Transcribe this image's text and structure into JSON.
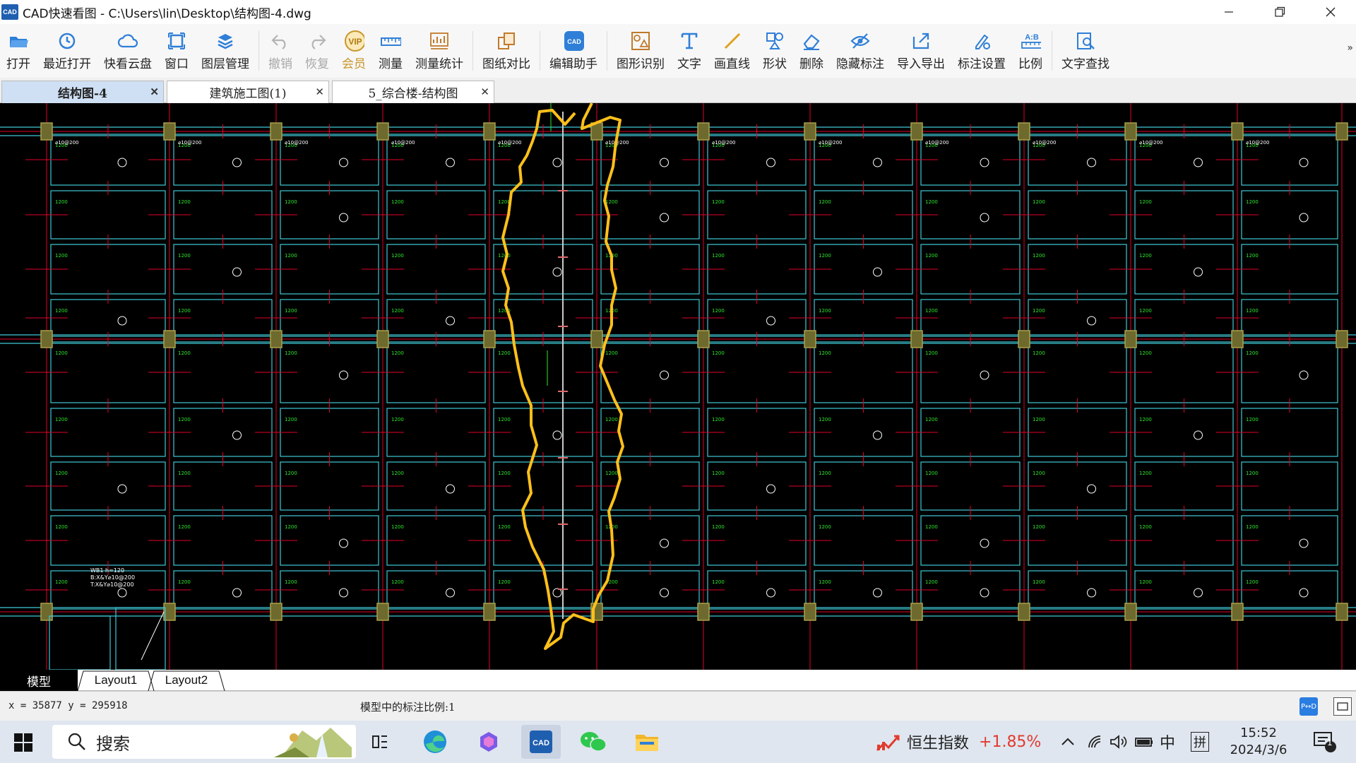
{
  "window": {
    "logo": "CAD",
    "title": "CAD快速看图 - C:\\Users\\lin\\Desktop\\结构图-4.dwg",
    "controls": [
      "minimize",
      "restore",
      "close"
    ]
  },
  "toolbar": {
    "buttons": [
      {
        "label": "打开",
        "icon": "folder-open-icon",
        "disabled": false
      },
      {
        "label": "最近打开",
        "icon": "recent-clock-icon",
        "disabled": false
      },
      {
        "label": "快看云盘",
        "icon": "cloud-icon",
        "disabled": false
      },
      {
        "label": "窗口",
        "icon": "window-icon",
        "disabled": false
      },
      {
        "label": "图层管理",
        "icon": "layers-icon",
        "disabled": false
      },
      {
        "label": "撤销",
        "icon": "undo-icon",
        "disabled": true
      },
      {
        "label": "恢复",
        "icon": "redo-icon",
        "disabled": true
      },
      {
        "label": "会员",
        "icon": "vip-icon",
        "disabled": false
      },
      {
        "label": "测量",
        "icon": "ruler-icon",
        "disabled": false
      },
      {
        "label": "测量统计",
        "icon": "measure-stats-icon",
        "disabled": false
      },
      {
        "label": "图纸对比",
        "icon": "compare-icon",
        "disabled": false
      },
      {
        "label": "编辑助手",
        "icon": "edit-assistant-icon",
        "disabled": false
      },
      {
        "label": "图形识别",
        "icon": "shape-recognize-icon",
        "disabled": false
      },
      {
        "label": "文字",
        "icon": "text-icon",
        "disabled": false
      },
      {
        "label": "画直线",
        "icon": "line-icon",
        "disabled": false
      },
      {
        "label": "形状",
        "icon": "shapes-icon",
        "disabled": false
      },
      {
        "label": "删除",
        "icon": "eraser-icon",
        "disabled": false
      },
      {
        "label": "隐藏标注",
        "icon": "hide-eye-icon",
        "disabled": false
      },
      {
        "label": "导入导出",
        "icon": "import-export-icon",
        "disabled": false
      },
      {
        "label": "标注设置",
        "icon": "annotation-settings-icon",
        "disabled": false
      },
      {
        "label": "比例",
        "icon": "scale-ratio-icon",
        "disabled": false
      },
      {
        "label": "文字查找",
        "icon": "text-search-icon",
        "disabled": false
      }
    ],
    "more": "»"
  },
  "tabs": [
    {
      "label": "结构图-4",
      "active": true
    },
    {
      "label": "建筑施工图(1)",
      "active": false
    },
    {
      "label": "5_综合楼-结构图",
      "active": false
    }
  ],
  "layout_tabs": [
    {
      "label": "模型",
      "active": true
    },
    {
      "label": "Layout1",
      "active": false
    },
    {
      "label": "Layout2",
      "active": false
    }
  ],
  "status": {
    "coord": "x = 35877 y = 295918",
    "scale_text": "模型中的标注比例:1",
    "pd_button": "P↔D"
  },
  "drawing": {
    "text_cell": "1200",
    "text_rebar": "⌀10@200",
    "text_beam": "WB1 h=120",
    "text_beam2": "B:X&Y⌀10@200",
    "text_beam3": "T:X&Y⌀10@200",
    "colors": {
      "background": "#000000",
      "grid": "#3fc8d6",
      "axis": "#e0002a",
      "column": "#a9a14a",
      "highlight": "#ffc01a",
      "text": "#ffffff",
      "green": "#2ee82e"
    }
  },
  "taskbar": {
    "search_label": "搜索",
    "stock_name": "恒生指数",
    "stock_change": "+1.85%",
    "ime": "中",
    "ime2": "拼",
    "time": "15:52",
    "date": "2024/3/6",
    "notif_count": "1"
  }
}
